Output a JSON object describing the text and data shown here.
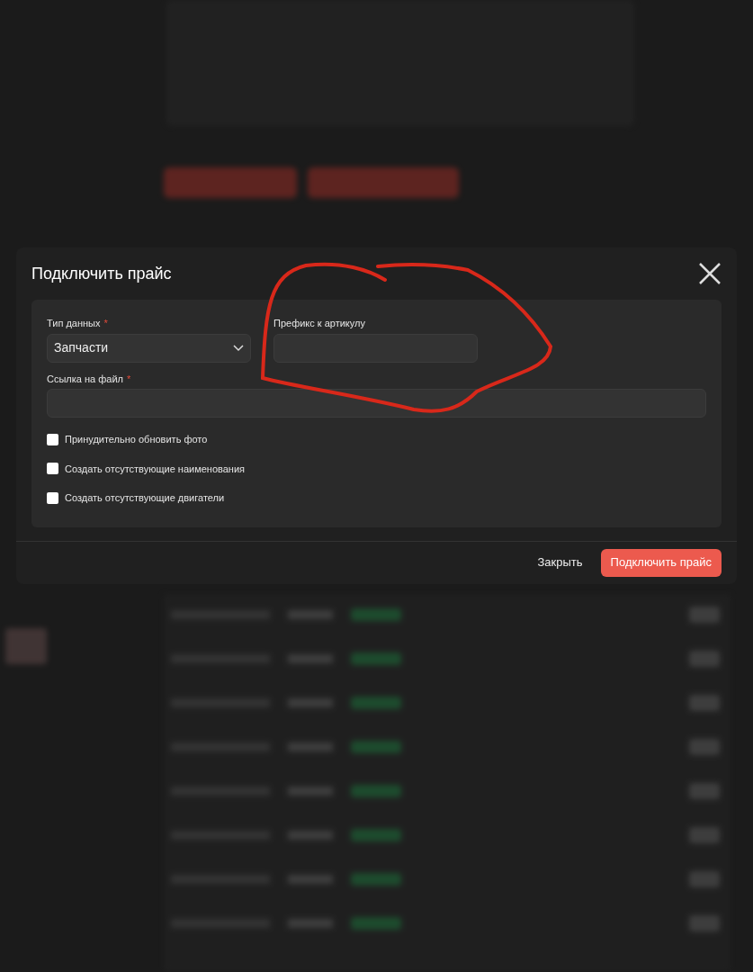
{
  "dialog": {
    "title": "Подключить прайс",
    "fields": [
      {
        "label": "Тип данных",
        "required_mark": "*",
        "kind": "select",
        "value": "Запчасти"
      },
      {
        "label": "Префикс к артикулу",
        "kind": "text"
      },
      {
        "label": "Ссылка на файл",
        "required_mark": "*",
        "kind": "text"
      }
    ],
    "options": [
      {
        "label": "Принудительно обновить фото",
        "checked": false
      },
      {
        "label": "Создать отсутствующие наименования",
        "checked": false
      },
      {
        "label": "Создать отсутствующие двигатели",
        "checked": false
      }
    ],
    "buttons": [
      {
        "label": "Закрыть",
        "kind": "secondary"
      },
      {
        "label": "Подключить прайс",
        "kind": "primary"
      }
    ]
  }
}
